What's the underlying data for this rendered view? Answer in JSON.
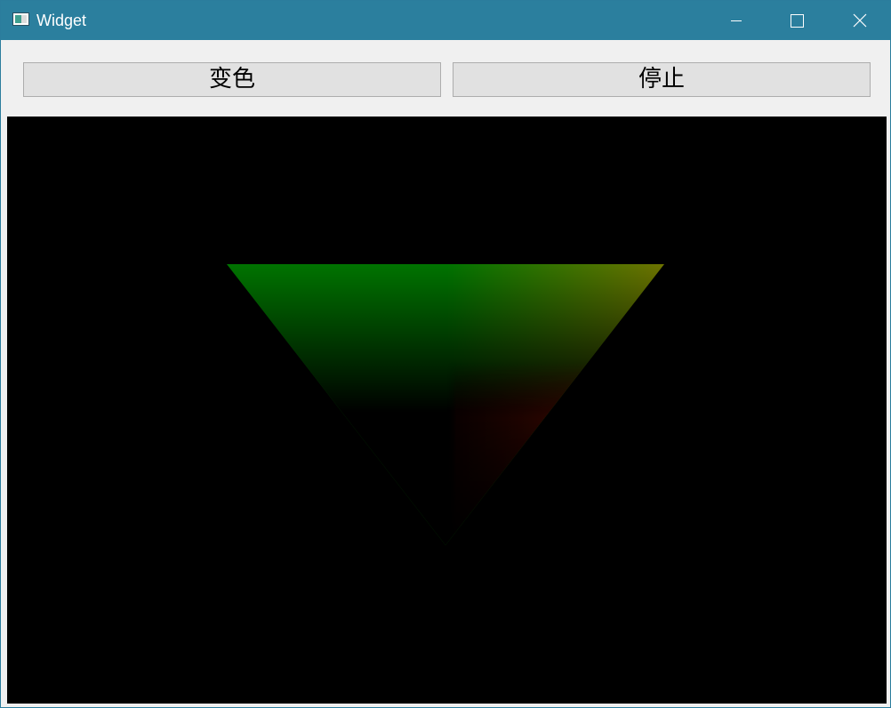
{
  "window": {
    "title": "Widget",
    "icon": "app-window-icon"
  },
  "titlebar_controls": {
    "minimize_icon": "minimize-icon",
    "maximize_icon": "maximize-icon",
    "close_icon": "close-icon"
  },
  "toolbar": {
    "change_color_label": "变色",
    "stop_label": "停止"
  },
  "canvas": {
    "background_color": "#000000",
    "shape": "triangle",
    "vertex_colors": [
      "#007300",
      "#737300",
      "#000000"
    ]
  },
  "colors": {
    "titlebar": "#2b7f9e",
    "window_bg": "#f0f0f0",
    "button_bg": "#e1e1e1",
    "button_border": "#adadad"
  }
}
